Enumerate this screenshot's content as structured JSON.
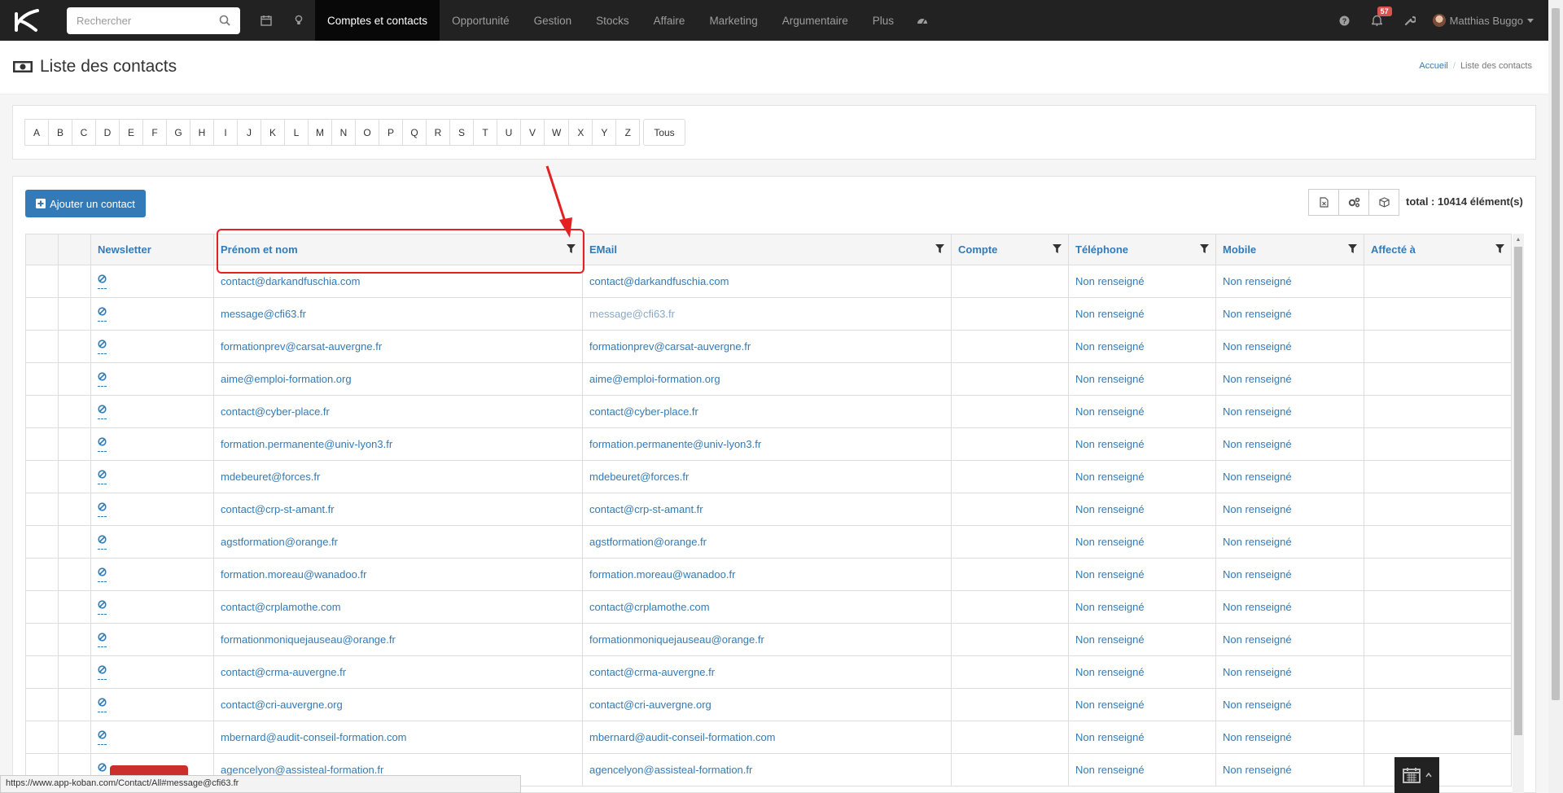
{
  "nav": {
    "search_placeholder": "Rechercher",
    "items": [
      "Comptes et contacts",
      "Opportunité",
      "Gestion",
      "Stocks",
      "Affaire",
      "Marketing",
      "Argumentaire",
      "Plus"
    ],
    "notifications_count": "57",
    "user_name": "Matthias Buggo"
  },
  "page": {
    "title": "Liste des contacts",
    "breadcrumb_home": "Accueil",
    "breadcrumb_current": "Liste des contacts"
  },
  "alphabet": {
    "letters": [
      "A",
      "B",
      "C",
      "D",
      "E",
      "F",
      "G",
      "H",
      "I",
      "J",
      "K",
      "L",
      "M",
      "N",
      "O",
      "P",
      "Q",
      "R",
      "S",
      "T",
      "U",
      "V",
      "W",
      "X",
      "Y",
      "Z"
    ],
    "all_label": "Tous"
  },
  "toolbar": {
    "add_label": "Ajouter un contact",
    "total": "total : 10414 élément(s)"
  },
  "table": {
    "columns": [
      "Newsletter",
      "Prénom et nom",
      "EMail",
      "Compte",
      "Téléphone",
      "Mobile",
      "Affecté à"
    ],
    "rows": [
      {
        "name": "contact@darkandfuschia.com",
        "email": "contact@darkandfuschia.com",
        "phone": "Non renseigné",
        "mobile": "Non renseigné"
      },
      {
        "name": "message@cfi63.fr",
        "email": "message@cfi63.fr",
        "phone": "Non renseigné",
        "mobile": "Non renseigné"
      },
      {
        "name": "formationprev@carsat-auvergne.fr",
        "email": "formationprev@carsat-auvergne.fr",
        "phone": "Non renseigné",
        "mobile": "Non renseigné"
      },
      {
        "name": "aime@emploi-formation.org",
        "email": "aime@emploi-formation.org",
        "phone": "Non renseigné",
        "mobile": "Non renseigné"
      },
      {
        "name": "contact@cyber-place.fr",
        "email": "contact@cyber-place.fr",
        "phone": "Non renseigné",
        "mobile": "Non renseigné"
      },
      {
        "name": "formation.permanente@univ-lyon3.fr",
        "email": "formation.permanente@univ-lyon3.fr",
        "phone": "Non renseigné",
        "mobile": "Non renseigné"
      },
      {
        "name": "mdebeuret@forces.fr",
        "email": "mdebeuret@forces.fr",
        "phone": "Non renseigné",
        "mobile": "Non renseigné"
      },
      {
        "name": "contact@crp-st-amant.fr",
        "email": "contact@crp-st-amant.fr",
        "phone": "Non renseigné",
        "mobile": "Non renseigné"
      },
      {
        "name": "agstformation@orange.fr",
        "email": "agstformation@orange.fr",
        "phone": "Non renseigné",
        "mobile": "Non renseigné"
      },
      {
        "name": "formation.moreau@wanadoo.fr",
        "email": "formation.moreau@wanadoo.fr",
        "phone": "Non renseigné",
        "mobile": "Non renseigné"
      },
      {
        "name": "contact@crplamothe.com",
        "email": "contact@crplamothe.com",
        "phone": "Non renseigné",
        "mobile": "Non renseigné"
      },
      {
        "name": "formationmoniquejauseau@orange.fr",
        "email": "formationmoniquejauseau@orange.fr",
        "phone": "Non renseigné",
        "mobile": "Non renseigné"
      },
      {
        "name": "contact@crma-auvergne.fr",
        "email": "contact@crma-auvergne.fr",
        "phone": "Non renseigné",
        "mobile": "Non renseigné"
      },
      {
        "name": "contact@cri-auvergne.org",
        "email": "contact@cri-auvergne.org",
        "phone": "Non renseigné",
        "mobile": "Non renseigné"
      },
      {
        "name": "mbernard@audit-conseil-formation.com",
        "email": "mbernard@audit-conseil-formation.com",
        "phone": "Non renseigné",
        "mobile": "Non renseigné"
      },
      {
        "name": "agencelyon@assisteal-formation.fr",
        "email": "agencelyon@assisteal-formation.fr",
        "phone": "Non renseigné",
        "mobile": "Non renseigné"
      }
    ]
  },
  "status_url": "https://www.app-koban.com/Contact/All#message@cfi63.fr",
  "colors": {
    "nav_bg": "#222222",
    "link": "#337ab7",
    "annotation": "#e32022",
    "badge": "#d9534f"
  }
}
